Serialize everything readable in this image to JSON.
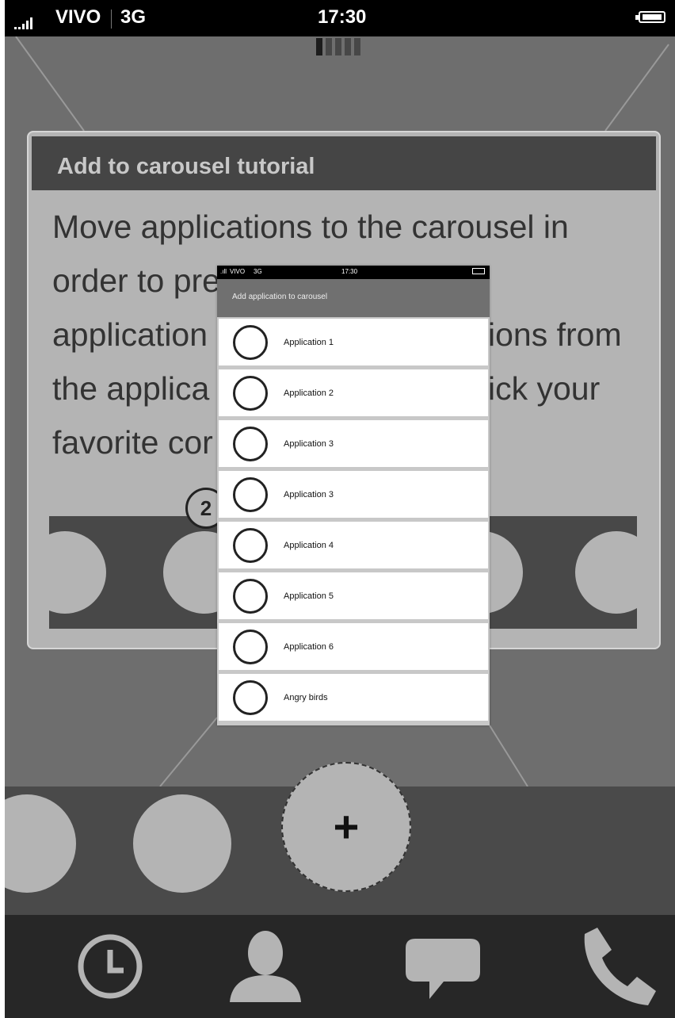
{
  "status_bar": {
    "carrier": "VIVO",
    "network": "3G",
    "time": "17:30"
  },
  "page_indicator": {
    "count": 5,
    "active": 1
  },
  "tutorial": {
    "title": "Add to carousel tutorial",
    "lines": [
      "Move applications to the carousel in",
      "order to pre",
      "application",
      "ions from",
      "the applica",
      "ick your",
      "favorite cor"
    ],
    "step_badge": "2"
  },
  "overlay": {
    "status": {
      "carrier": "VIVO",
      "network": "3G",
      "time": "17:30"
    },
    "title": "Add application to carousel",
    "items": [
      "Application 1",
      "Application 2",
      "Application 3",
      "Application 3",
      "Application 4",
      "Application 5",
      "Application 6",
      "Angry birds"
    ]
  },
  "dock": {
    "add_label": "+"
  },
  "tab_bar": {
    "icons": [
      "clock-icon",
      "contacts-icon",
      "messages-icon",
      "phone-icon"
    ]
  },
  "colors": {
    "background": "#6e6e6e",
    "panel": "#b4b4b4",
    "header": "#454545",
    "dock": "#4a4a4a",
    "tab_bar": "#272727",
    "tab_icon": "#b4b4b4"
  }
}
